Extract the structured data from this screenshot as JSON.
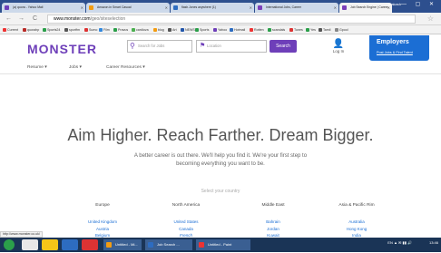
{
  "browser": {
    "tabs": [
      {
        "label": "(a) quora - Yahoo Mail",
        "color": "#6e3fb9"
      },
      {
        "label": "Amazon.in Smart Casual",
        "color": "#f39c12"
      },
      {
        "label": "flash.Jones anywhere (1)",
        "color": "#2d6cc0"
      },
      {
        "label": "International Jobs, Career",
        "color": "#7b3fb9"
      },
      {
        "label": "Job Search Engine | Career",
        "color": "#7b3fb9"
      }
    ],
    "user": "prakash",
    "window_controls": "— ▢ ✕",
    "back_icon": "←",
    "forward_icon": "→",
    "reload_icon": "C",
    "url_host": "www.monster.com",
    "url_path": "/geo/siteselection",
    "star_icon": "☆",
    "bookmarks": [
      {
        "label": "Current",
        "color": "#e33"
      },
      {
        "label": "quorahp",
        "color": "#b92b27"
      },
      {
        "label": "Sports24",
        "color": "#2b9f4a"
      },
      {
        "label": "sportfm",
        "color": "#555"
      },
      {
        "label": "Sumo",
        "color": "#d33"
      },
      {
        "label": "Film",
        "color": "#3388dd"
      },
      {
        "label": "Pravus",
        "color": "#2b9f4a"
      },
      {
        "label": "cardiova",
        "color": "#4caf50"
      },
      {
        "label": "blog",
        "color": "#f39c12"
      },
      {
        "label": "Art",
        "color": "#555"
      },
      {
        "label": "NEWS",
        "color": "#2255aa"
      },
      {
        "label": "Sports",
        "color": "#2b9f4a"
      },
      {
        "label": "Yahoo",
        "color": "#6e3fb9"
      },
      {
        "label": "Hotmail",
        "color": "#2d6cc0"
      },
      {
        "label": "Rotten",
        "color": "#e33"
      },
      {
        "label": "scandals",
        "color": "#2b9f4a"
      },
      {
        "label": "Tunes",
        "color": "#d33"
      },
      {
        "label": "Yes",
        "color": "#2b9f4a"
      },
      {
        "label": "Tamil",
        "color": "#555"
      },
      {
        "label": "Gpool",
        "color": "#888"
      }
    ]
  },
  "employers": {
    "title": "Employers",
    "subtitle": "Post Jobs & Find Talent"
  },
  "header": {
    "logo": "MONSTER",
    "search_placeholder": "Search for Jobs",
    "search_icon": "⚲",
    "location_placeholder": "Location",
    "location_icon": "⚑",
    "search_button": "Search",
    "login_label": "Log In",
    "login_icon": "👤"
  },
  "subnav": [
    {
      "label": "Resume ▾"
    },
    {
      "label": "Jobs ▾"
    },
    {
      "label": "Career Resources ▾"
    }
  ],
  "hero": {
    "headline": "Aim Higher. Reach Farther. Dream Bigger.",
    "tagline": "A better career is out there. We'll help you find it. We're your first step to becoming everything you want to be."
  },
  "select_country": "Select your country",
  "regions": [
    {
      "title": "Europe",
      "links": [
        "United Kingdom",
        "Austria",
        "Belgium",
        "Dutch",
        "French"
      ]
    },
    {
      "title": "North America",
      "links": [
        "United States",
        "Canada",
        "French",
        "English"
      ]
    },
    {
      "title": "Middle East",
      "links": [
        "Bahrain",
        "Jordan",
        "Kuwait",
        "Lebanon",
        "Oman"
      ]
    },
    {
      "title": "Asia & Pacific Rim",
      "links": [
        "Australia",
        "Hong Kong",
        "India",
        "Indonesia",
        "Korea"
      ]
    }
  ],
  "status_url": "http://www.monster.co.uk/",
  "taskbar": {
    "apps": [
      {
        "color": "#e8e8e8"
      },
      {
        "color": "#f5c518"
      },
      {
        "color": "#2d6cc0"
      },
      {
        "color": "#d33"
      }
    ],
    "tasks": [
      {
        "label": "Untitled - Mi...",
        "color": "#f39c12"
      },
      {
        "label": "Job Search ...",
        "color": "#2d6cc0"
      },
      {
        "label": "Untitled - Paint",
        "color": "#e33"
      }
    ],
    "tray": "EN ▲ ✉ ▮▮ 🔊",
    "time": "13:46"
  }
}
